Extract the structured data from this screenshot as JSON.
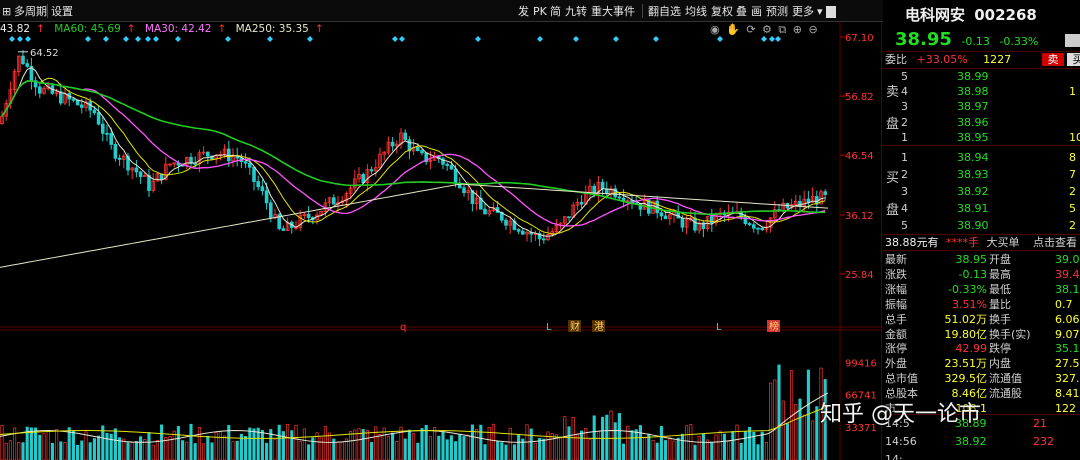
{
  "toolbar": {
    "left_items": [
      "多周期",
      "设置"
    ],
    "right_items": [
      "发",
      "PK",
      "简",
      "九转",
      "重大事件",
      "翻自选",
      "均线",
      "复权",
      "叠",
      "画",
      "预测",
      "更多"
    ],
    "right_panel_marker": "R"
  },
  "ma_legend": {
    "ma_first": "43.82",
    "ma60": "MA60: 45.69",
    "ma30": "MA30: 42.42",
    "ma250": "MA250: 35.35"
  },
  "price_axis": {
    "labels": [
      "67.10",
      "56.82",
      "46.54",
      "36.12",
      "25.84"
    ],
    "max_marker": "64.52"
  },
  "volume_axis": {
    "labels": [
      "99416",
      "66741",
      "33371"
    ]
  },
  "event_markers": [
    "q",
    "L",
    "财",
    "港",
    "L",
    "榜"
  ],
  "stock": {
    "name": "电科网安",
    "code": "002268",
    "price": "38.95",
    "change": "-0.13",
    "change_pct": "-0.33%",
    "weibi_label": "委比",
    "weibi_value": "+33.05%",
    "weicha_value": "1227",
    "sell_btn": "卖",
    "buy_btn": "买"
  },
  "order_book": {
    "sell": [
      {
        "level": "5",
        "price": "38.99",
        "vol": ""
      },
      {
        "level": "4",
        "price": "38.98",
        "vol": "1"
      },
      {
        "level": "3",
        "price": "38.97",
        "vol": ""
      },
      {
        "level": "2",
        "price": "38.96",
        "vol": ""
      },
      {
        "level": "1",
        "price": "38.95",
        "vol": "10"
      }
    ],
    "buy": [
      {
        "level": "1",
        "price": "38.94",
        "vol": "8"
      },
      {
        "level": "2",
        "price": "38.93",
        "vol": "7"
      },
      {
        "level": "3",
        "price": "38.92",
        "vol": "2"
      },
      {
        "level": "4",
        "price": "38.91",
        "vol": "5"
      },
      {
        "level": "5",
        "price": "38.90",
        "vol": "2"
      }
    ],
    "sell_side_label": [
      "卖",
      "盘"
    ],
    "buy_side_label": [
      "买",
      "盘"
    ]
  },
  "quick_trade": {
    "price": "38.88元有",
    "qty": "****手",
    "label": "大买单",
    "link": "点击查看"
  },
  "quote_stats": [
    {
      "l1": "最新",
      "v1": "38.95",
      "l2": "开盘",
      "v2": "39.0"
    },
    {
      "l1": "涨跌",
      "v1": "-0.13",
      "l2": "最高",
      "v2": "39.4"
    },
    {
      "l1": "涨幅",
      "v1": "-0.33%",
      "l2": "最低",
      "v2": "38.1"
    },
    {
      "l1": "振幅",
      "v1": "3.51%",
      "l2": "量比",
      "v2": "0.7"
    },
    {
      "l1": "总手",
      "v1": "51.02万",
      "l2": "换手",
      "v2": "6.06"
    },
    {
      "l1": "金额",
      "v1": "19.80亿",
      "l2": "换手(实)",
      "v2": "9.07"
    },
    {
      "l1": "涨停",
      "v1": "42.99",
      "l2": "跌停",
      "v2": "35.1"
    },
    {
      "l1": "外盘",
      "v1": "23.51万",
      "l2": "内盘",
      "v2": "27.51"
    },
    {
      "l1": "总市值",
      "v1": "329.5亿",
      "l2": "流通值",
      "v2": "327.7"
    },
    {
      "l1": "总股本",
      "v1": "8.46亿",
      "l2": "流通股",
      "v2": "8.41"
    },
    {
      "l1": "市",
      "v1": "108.1",
      "l2": "",
      "v2": "122"
    }
  ],
  "ticks": [
    {
      "time": "14:5",
      "price": "38.89",
      "vol": "21"
    },
    {
      "time": "14:56",
      "price": "38.92",
      "vol": "232"
    },
    {
      "time": "14:",
      "price": "",
      "vol": ""
    }
  ],
  "watermark": "知乎 @天一论市",
  "colors": {
    "up": "#ff3333",
    "down": "#22dd22",
    "ma_white": "#e8e8d0",
    "ma_yellow": "#e6e600",
    "ma_magenta": "#ff55ff",
    "ma_green": "#22cc22",
    "ma250": "#e6e6c8",
    "axis_red": "#ff3333",
    "event_marker": "#33ccff"
  }
}
